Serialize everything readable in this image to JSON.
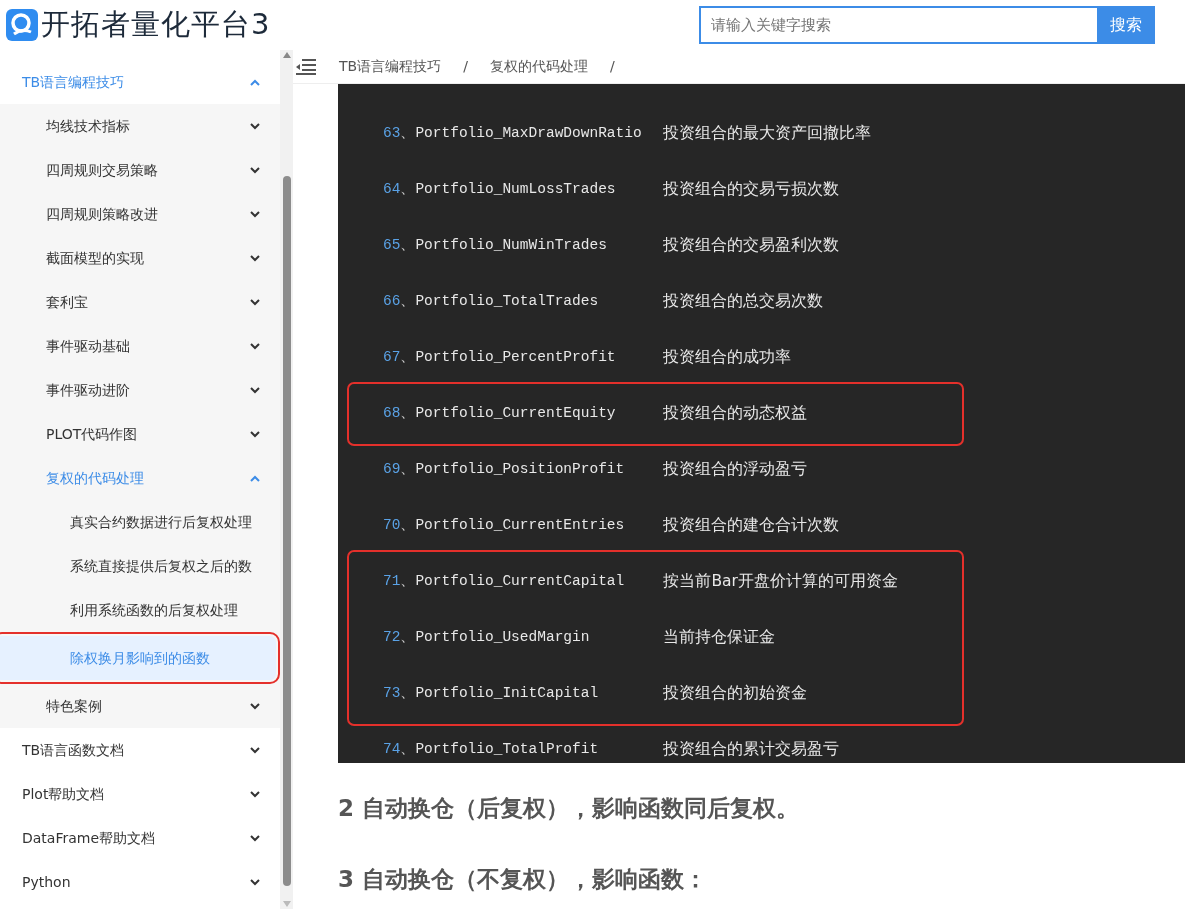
{
  "header": {
    "logo_text": "开拓者量化平台3",
    "search": {
      "placeholder": "请输入关键字搜索",
      "button": "搜索"
    }
  },
  "sidebar": {
    "items": [
      {
        "label": "TB语言编程技巧",
        "expanded": true,
        "selected": false,
        "annotated": false,
        "children": [
          {
            "label": "均线技术指标",
            "expanded": false,
            "selected": false,
            "annotated": false
          },
          {
            "label": "四周规则交易策略",
            "expanded": false,
            "selected": false,
            "annotated": false
          },
          {
            "label": "四周规则策略改进",
            "expanded": false,
            "selected": false,
            "annotated": false
          },
          {
            "label": "截面模型的实现",
            "expanded": false,
            "selected": false,
            "annotated": false
          },
          {
            "label": "套利宝",
            "expanded": false,
            "selected": false,
            "annotated": false
          },
          {
            "label": "事件驱动基础",
            "expanded": false,
            "selected": false,
            "annotated": false
          },
          {
            "label": "事件驱动进阶",
            "expanded": false,
            "selected": false,
            "annotated": false
          },
          {
            "label": "PLOT代码作图",
            "expanded": false,
            "selected": false,
            "annotated": false
          },
          {
            "label": "复权的代码处理",
            "expanded": true,
            "selected": false,
            "annotated": false,
            "children": [
              {
                "label": "真实合约数据进行后复权处理",
                "selected": false,
                "annotated": false
              },
              {
                "label": "系统直接提供后复权之后的数",
                "selected": false,
                "annotated": false
              },
              {
                "label": "利用系统函数的后复权处理",
                "selected": false,
                "annotated": false
              },
              {
                "label": "除权换月影响到的函数",
                "selected": true,
                "annotated": true
              }
            ]
          },
          {
            "label": "特色案例",
            "expanded": false,
            "selected": false,
            "annotated": false
          }
        ]
      },
      {
        "label": "TB语言函数文档",
        "expanded": false,
        "selected": false,
        "annotated": false
      },
      {
        "label": "Plot帮助文档",
        "expanded": false,
        "selected": false,
        "annotated": false
      },
      {
        "label": "DataFrame帮助文档",
        "expanded": false,
        "selected": false,
        "annotated": false
      },
      {
        "label": "Python",
        "expanded": false,
        "selected": false,
        "annotated": false
      }
    ]
  },
  "breadcrumb": [
    {
      "label": "TB语言编程技巧",
      "separator": "/"
    },
    {
      "label": "复权的代码处理",
      "separator": "/"
    }
  ],
  "code_separator": "、",
  "code_groups": [
    {
      "annotated": false,
      "rows": [
        {
          "number": "63",
          "name": "Portfolio_MaxDrawDownRatio",
          "description": "投资组合的最大资产回撤比率"
        },
        {
          "number": "64",
          "name": "Portfolio_NumLossTrades",
          "description": "投资组合的交易亏损次数"
        },
        {
          "number": "65",
          "name": "Portfolio_NumWinTrades",
          "description": "投资组合的交易盈利次数"
        },
        {
          "number": "66",
          "name": "Portfolio_TotalTrades",
          "description": "投资组合的总交易次数"
        },
        {
          "number": "67",
          "name": "Portfolio_PercentProfit",
          "description": "投资组合的成功率"
        }
      ]
    },
    {
      "annotated": true,
      "rows": [
        {
          "number": "68",
          "name": "Portfolio_CurrentEquity",
          "description": "投资组合的动态权益"
        }
      ]
    },
    {
      "annotated": false,
      "rows": [
        {
          "number": "69",
          "name": "Portfolio_PositionProfit",
          "description": "投资组合的浮动盈亏"
        },
        {
          "number": "70",
          "name": "Portfolio_CurrentEntries",
          "description": "投资组合的建仓合计次数"
        }
      ]
    },
    {
      "annotated": true,
      "rows": [
        {
          "number": "71",
          "name": "Portfolio_CurrentCapital",
          "description": "按当前Bar开盘价计算的可用资金"
        },
        {
          "number": "72",
          "name": "Portfolio_UsedMargin",
          "description": "当前持仓保证金"
        },
        {
          "number": "73",
          "name": "Portfolio_InitCapital",
          "description": "投资组合的初始资金"
        }
      ]
    },
    {
      "annotated": false,
      "rows": [
        {
          "number": "74",
          "name": "Portfolio_TotalProfit",
          "description": "投资组合的累计交易盈亏"
        }
      ]
    }
  ],
  "headings": [
    "2 自动换仓（后复权），影响函数同后复权。",
    "3 自动换仓（不复权），影响函数："
  ]
}
